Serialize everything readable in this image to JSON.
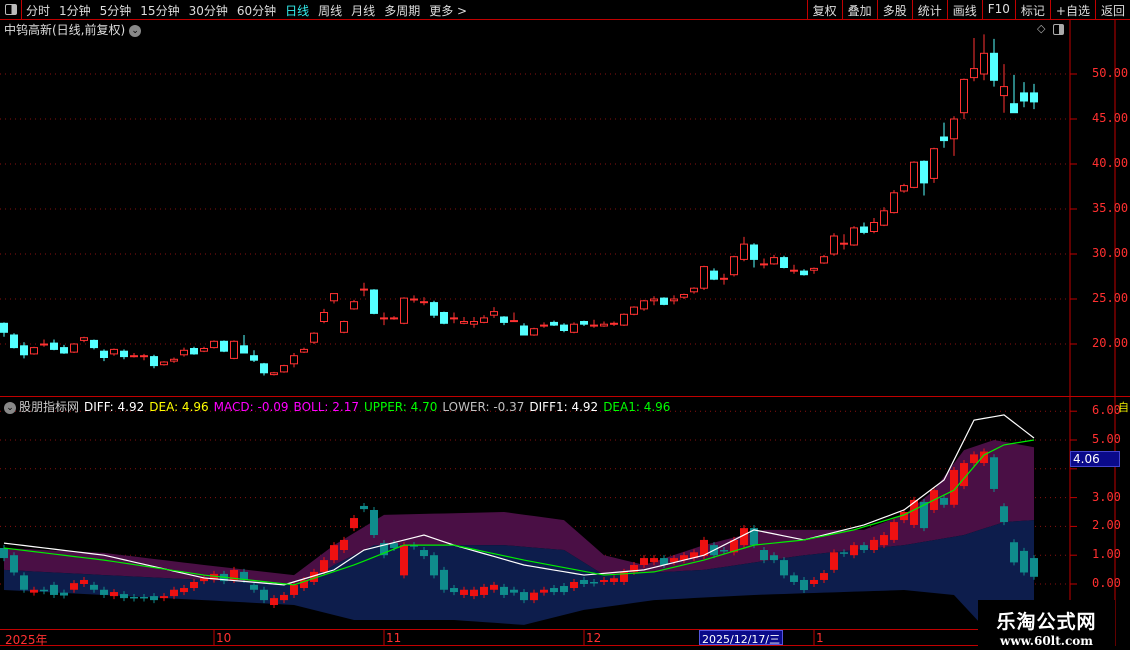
{
  "toolbar": {
    "periods": [
      "分时",
      "1分钟",
      "5分钟",
      "15分钟",
      "30分钟",
      "60分钟",
      "日线",
      "周线",
      "月线",
      "多周期",
      "更多 >"
    ],
    "active_period": "日线",
    "right_buttons": [
      "复权",
      "叠加",
      "多股",
      "统计",
      "画线",
      "F10",
      "标记",
      "+自选",
      "返回"
    ]
  },
  "chart": {
    "title": "中钨高新(日线,前复权)",
    "price_axis": [
      "50.00",
      "45.00",
      "40.00",
      "35.00",
      "30.00",
      "25.00",
      "20.00"
    ],
    "candles_ohlc": [
      [
        22.3,
        22.4,
        20.8,
        21.3
      ],
      [
        21.0,
        21.2,
        19.5,
        19.6
      ],
      [
        19.8,
        20.2,
        18.4,
        18.8
      ],
      [
        18.9,
        19.7,
        18.8,
        19.6
      ],
      [
        20.0,
        20.5,
        19.7,
        20.0
      ],
      [
        20.1,
        20.5,
        19.3,
        19.4
      ],
      [
        19.6,
        19.9,
        18.9,
        19.0
      ],
      [
        19.1,
        20.1,
        19.0,
        20.0
      ],
      [
        20.4,
        20.8,
        20.2,
        20.7
      ],
      [
        20.4,
        20.5,
        19.4,
        19.6
      ],
      [
        19.2,
        19.4,
        18.1,
        18.5
      ],
      [
        18.9,
        19.5,
        18.7,
        19.4
      ],
      [
        19.2,
        19.4,
        18.3,
        18.6
      ],
      [
        18.7,
        19.0,
        18.5,
        18.7
      ],
      [
        18.7,
        18.9,
        18.2,
        18.7
      ],
      [
        18.6,
        18.8,
        17.3,
        17.6
      ],
      [
        17.7,
        18.1,
        17.6,
        18.0
      ],
      [
        18.1,
        18.5,
        17.9,
        18.3
      ],
      [
        18.8,
        19.6,
        18.6,
        19.3
      ],
      [
        19.5,
        19.7,
        18.8,
        18.9
      ],
      [
        19.2,
        19.7,
        19.1,
        19.5
      ],
      [
        19.6,
        20.4,
        19.5,
        20.3
      ],
      [
        20.3,
        20.4,
        19.1,
        19.2
      ],
      [
        18.4,
        20.4,
        18.3,
        20.3
      ],
      [
        19.8,
        21.0,
        19.5,
        19.0
      ],
      [
        18.7,
        19.3,
        18.0,
        18.2
      ],
      [
        17.8,
        17.9,
        16.5,
        16.8
      ],
      [
        16.6,
        16.9,
        16.5,
        16.8
      ],
      [
        16.9,
        17.7,
        16.8,
        17.6
      ],
      [
        17.8,
        19.0,
        17.4,
        18.7
      ],
      [
        19.1,
        19.6,
        19.0,
        19.4
      ],
      [
        20.2,
        21.3,
        20.0,
        21.2
      ],
      [
        22.5,
        23.9,
        22.3,
        23.5
      ],
      [
        24.8,
        25.6,
        24.5,
        25.6
      ],
      [
        21.3,
        22.6,
        21.2,
        22.5
      ],
      [
        23.9,
        24.9,
        23.8,
        24.7
      ],
      [
        26.1,
        26.8,
        25.3,
        26.1
      ],
      [
        26.0,
        26.1,
        23.3,
        23.4
      ],
      [
        22.9,
        23.5,
        22.1,
        22.9
      ],
      [
        22.9,
        23.1,
        22.7,
        22.9
      ],
      [
        22.3,
        25.2,
        22.2,
        25.1
      ],
      [
        25.0,
        25.4,
        24.6,
        25.0
      ],
      [
        24.7,
        25.2,
        24.3,
        24.7
      ],
      [
        24.6,
        24.8,
        22.9,
        23.2
      ],
      [
        23.5,
        23.6,
        22.2,
        22.3
      ],
      [
        22.9,
        23.5,
        22.3,
        22.9
      ],
      [
        22.3,
        23.0,
        22.2,
        22.5
      ],
      [
        22.2,
        23.0,
        21.8,
        22.5
      ],
      [
        22.4,
        23.2,
        22.3,
        22.9
      ],
      [
        23.2,
        24.1,
        22.9,
        23.6
      ],
      [
        23.0,
        23.1,
        22.1,
        22.4
      ],
      [
        22.6,
        23.5,
        22.5,
        22.6
      ],
      [
        22.0,
        22.3,
        21.0,
        21.0
      ],
      [
        21.0,
        21.8,
        20.9,
        21.7
      ],
      [
        22.1,
        22.4,
        21.8,
        22.1
      ],
      [
        22.4,
        22.6,
        22.0,
        22.1
      ],
      [
        22.1,
        22.3,
        21.3,
        21.5
      ],
      [
        21.3,
        22.4,
        21.2,
        22.2
      ],
      [
        22.5,
        22.6,
        22.0,
        22.2
      ],
      [
        22.1,
        22.7,
        21.8,
        22.1
      ],
      [
        22.0,
        22.5,
        21.9,
        22.2
      ],
      [
        22.3,
        22.5,
        22.0,
        22.3
      ],
      [
        22.1,
        23.4,
        22.0,
        23.3
      ],
      [
        23.3,
        24.2,
        23.2,
        24.1
      ],
      [
        23.9,
        24.9,
        23.7,
        24.8
      ],
      [
        24.8,
        25.3,
        24.3,
        25.0
      ],
      [
        25.1,
        25.2,
        24.3,
        24.4
      ],
      [
        24.8,
        25.4,
        24.4,
        25.0
      ],
      [
        25.2,
        25.6,
        25.0,
        25.5
      ],
      [
        25.8,
        26.3,
        25.6,
        26.2
      ],
      [
        26.2,
        28.7,
        26.0,
        28.6
      ],
      [
        28.1,
        28.4,
        27.1,
        27.2
      ],
      [
        27.3,
        27.8,
        26.6,
        27.3
      ],
      [
        27.7,
        29.8,
        27.5,
        29.7
      ],
      [
        29.4,
        31.9,
        29.2,
        31.1
      ],
      [
        31.0,
        31.2,
        28.5,
        29.4
      ],
      [
        28.9,
        29.5,
        28.4,
        28.9
      ],
      [
        28.9,
        29.9,
        28.8,
        29.6
      ],
      [
        29.6,
        29.8,
        28.4,
        28.5
      ],
      [
        28.2,
        28.8,
        27.8,
        28.2
      ],
      [
        28.1,
        28.3,
        27.6,
        27.7
      ],
      [
        28.2,
        28.5,
        27.8,
        28.4
      ],
      [
        29.0,
        29.9,
        28.9,
        29.7
      ],
      [
        30.0,
        32.3,
        29.8,
        32.0
      ],
      [
        31.2,
        32.2,
        30.5,
        31.2
      ],
      [
        31.0,
        33.1,
        30.9,
        32.9
      ],
      [
        33.0,
        33.5,
        32.2,
        32.4
      ],
      [
        32.5,
        34.0,
        32.3,
        33.5
      ],
      [
        33.2,
        35.2,
        33.1,
        34.8
      ],
      [
        34.6,
        37.1,
        34.5,
        36.8
      ],
      [
        37.0,
        37.8,
        36.8,
        37.6
      ],
      [
        37.4,
        40.3,
        37.3,
        40.2
      ],
      [
        40.3,
        40.4,
        36.5,
        37.9
      ],
      [
        38.4,
        41.8,
        37.9,
        41.7
      ],
      [
        43.0,
        44.6,
        41.8,
        42.6
      ],
      [
        42.8,
        45.3,
        40.9,
        45.0
      ],
      [
        45.7,
        49.5,
        45.0,
        49.4
      ],
      [
        49.6,
        54.0,
        49.2,
        50.6
      ],
      [
        50.0,
        54.4,
        49.3,
        52.3
      ],
      [
        52.3,
        53.9,
        48.6,
        49.3
      ],
      [
        47.6,
        51.1,
        45.7,
        48.6
      ],
      [
        46.7,
        49.9,
        45.8,
        45.7
      ],
      [
        47.9,
        49.1,
        46.3,
        47.0
      ],
      [
        47.9,
        48.9,
        46.1,
        46.9
      ]
    ]
  },
  "indicator": {
    "name": "股朋指标网",
    "values": [
      {
        "label": "DIFF: 4.92",
        "color": "#ffffff"
      },
      {
        "label": "DEA: 4.96",
        "color": "#ffff00"
      },
      {
        "label": "MACD: -0.09",
        "color": "#ff00ff"
      },
      {
        "label": "BOLL: 2.17",
        "color": "#ff00ff"
      },
      {
        "label": "UPPER: 4.70",
        "color": "#00ff00"
      },
      {
        "label": "LOWER: -0.37",
        "color": "#c0c0c0"
      },
      {
        "label": "DIFF1: 4.92",
        "color": "#ffffff"
      },
      {
        "label": "DEA1: 4.96",
        "color": "#00ff00"
      }
    ],
    "axis": [
      "6.00",
      "5.00",
      "3.00",
      "2.00",
      "1.00",
      "0.00"
    ],
    "current_label": "4.06",
    "colors": {
      "upper_fill": "#4a0f45",
      "lower_fill": "#0d1d4c",
      "white_line": "#ffffff",
      "green_line": "#00ee00",
      "up": "#ee1111",
      "down": "#0f8c8c"
    },
    "upper_band": [
      [
        0,
        1.25
      ],
      [
        10,
        1.08
      ],
      [
        20,
        0.66
      ],
      [
        29,
        0.31
      ],
      [
        33,
        1.35
      ],
      [
        38,
        2.4
      ],
      [
        50,
        2.5
      ],
      [
        56,
        2.22
      ],
      [
        60,
        1.0
      ],
      [
        64,
        0.66
      ],
      [
        70,
        1.35
      ],
      [
        76,
        1.88
      ],
      [
        86,
        1.88
      ],
      [
        90,
        2.4
      ],
      [
        93,
        3.26
      ],
      [
        96,
        4.65
      ],
      [
        99,
        5.0
      ],
      [
        103,
        4.75
      ]
    ],
    "mid_band": [
      [
        0,
        0.49
      ],
      [
        10,
        0.31
      ],
      [
        20,
        0.14
      ],
      [
        30,
        -0.03
      ],
      [
        33,
        0.66
      ],
      [
        37,
        1.35
      ],
      [
        50,
        1.35
      ],
      [
        56,
        1.18
      ],
      [
        60,
        0.31
      ],
      [
        70,
        0.49
      ],
      [
        80,
        1.0
      ],
      [
        90,
        1.35
      ],
      [
        96,
        1.7
      ],
      [
        100,
        2.15
      ],
      [
        103,
        2.22
      ]
    ],
    "lower_band": [
      [
        0,
        -0.21
      ],
      [
        10,
        -0.38
      ],
      [
        20,
        -0.56
      ],
      [
        29,
        -0.73
      ],
      [
        35,
        -1.25
      ],
      [
        45,
        -1.25
      ],
      [
        52,
        -1.42
      ],
      [
        58,
        -0.9
      ],
      [
        65,
        -0.56
      ],
      [
        75,
        -0.38
      ],
      [
        90,
        -0.21
      ],
      [
        95,
        -0.38
      ],
      [
        98,
        -1.5
      ],
      [
        103,
        -0.56
      ]
    ],
    "white_line": [
      [
        0,
        1.42
      ],
      [
        10,
        1.0
      ],
      [
        20,
        0.21
      ],
      [
        28,
        -0.03
      ],
      [
        33,
        0.49
      ],
      [
        36,
        1.18
      ],
      [
        42,
        1.7
      ],
      [
        45,
        1.35
      ],
      [
        52,
        0.66
      ],
      [
        58,
        0.31
      ],
      [
        64,
        0.49
      ],
      [
        70,
        1.0
      ],
      [
        75,
        1.88
      ],
      [
        80,
        1.53
      ],
      [
        86,
        2.05
      ],
      [
        90,
        2.57
      ],
      [
        94,
        3.61
      ],
      [
        97,
        5.69
      ],
      [
        100,
        5.87
      ],
      [
        103,
        5.07
      ]
    ],
    "green_line": [
      [
        0,
        1.25
      ],
      [
        10,
        0.83
      ],
      [
        20,
        0.31
      ],
      [
        29,
        -0.03
      ],
      [
        35,
        0.66
      ],
      [
        40,
        1.35
      ],
      [
        45,
        1.35
      ],
      [
        52,
        0.83
      ],
      [
        60,
        0.31
      ],
      [
        65,
        0.42
      ],
      [
        70,
        0.83
      ],
      [
        75,
        1.35
      ],
      [
        80,
        1.53
      ],
      [
        85,
        1.88
      ],
      [
        90,
        2.4
      ],
      [
        95,
        3.26
      ],
      [
        98,
        4.48
      ],
      [
        100,
        4.83
      ],
      [
        103,
        5.0
      ]
    ],
    "candles_oc": [
      [
        1.25,
        0.9
      ],
      [
        1.0,
        0.4
      ],
      [
        0.3,
        -0.2
      ],
      [
        -0.3,
        -0.2
      ],
      [
        -0.2,
        -0.2
      ],
      [
        -0.03,
        -0.38
      ],
      [
        -0.3,
        -0.4
      ],
      [
        -0.2,
        0.03
      ],
      [
        0.0,
        0.14
      ],
      [
        -0.03,
        -0.2
      ],
      [
        -0.2,
        -0.38
      ],
      [
        -0.42,
        -0.28
      ],
      [
        -0.35,
        -0.49
      ],
      [
        -0.45,
        -0.45
      ],
      [
        -0.45,
        -0.45
      ],
      [
        -0.42,
        -0.56
      ],
      [
        -0.49,
        -0.42
      ],
      [
        -0.42,
        -0.2
      ],
      [
        -0.28,
        -0.14
      ],
      [
        -0.14,
        0.07
      ],
      [
        0.1,
        0.2
      ],
      [
        0.15,
        0.35
      ],
      [
        0.35,
        0.1
      ],
      [
        0.14,
        0.49
      ],
      [
        0.42,
        0.14
      ],
      [
        -0.03,
        -0.2
      ],
      [
        -0.2,
        -0.56
      ],
      [
        -0.73,
        -0.49
      ],
      [
        -0.56,
        -0.38
      ],
      [
        -0.38,
        -0.03
      ],
      [
        -0.14,
        0.14
      ],
      [
        0.07,
        0.42
      ],
      [
        0.42,
        0.83
      ],
      [
        0.83,
        1.35
      ],
      [
        1.18,
        1.53
      ],
      [
        1.94,
        2.29
      ],
      [
        2.71,
        2.6
      ],
      [
        2.57,
        1.7
      ],
      [
        1.42,
        1.0
      ],
      [
        1.42,
        1.25
      ],
      [
        0.3,
        1.35
      ],
      [
        1.35,
        1.35
      ],
      [
        1.18,
        0.97
      ],
      [
        1.0,
        0.3
      ],
      [
        0.49,
        -0.2
      ],
      [
        -0.14,
        -0.28
      ],
      [
        -0.38,
        -0.2
      ],
      [
        -0.42,
        -0.2
      ],
      [
        -0.38,
        -0.1
      ],
      [
        -0.2,
        -0.03
      ],
      [
        -0.1,
        -0.38
      ],
      [
        -0.2,
        -0.3
      ],
      [
        -0.28,
        -0.56
      ],
      [
        -0.56,
        -0.3
      ],
      [
        -0.3,
        -0.2
      ],
      [
        -0.14,
        -0.28
      ],
      [
        -0.07,
        -0.28
      ],
      [
        -0.14,
        0.07
      ],
      [
        0.14,
        0.0
      ],
      [
        0.07,
        0.07
      ],
      [
        0.07,
        0.14
      ],
      [
        0.07,
        0.2
      ],
      [
        0.07,
        0.42
      ],
      [
        0.42,
        0.66
      ],
      [
        0.66,
        0.9
      ],
      [
        0.76,
        0.9
      ],
      [
        0.9,
        0.66
      ],
      [
        0.76,
        0.9
      ],
      [
        0.83,
        1.0
      ],
      [
        0.9,
        1.1
      ],
      [
        0.97,
        1.53
      ],
      [
        1.35,
        1.0
      ],
      [
        1.18,
        1.18
      ],
      [
        1.1,
        1.53
      ],
      [
        1.35,
        1.94
      ],
      [
        1.94,
        1.35
      ],
      [
        1.18,
        0.83
      ],
      [
        1.0,
        0.83
      ],
      [
        0.83,
        0.3
      ],
      [
        0.3,
        0.07
      ],
      [
        0.14,
        -0.21
      ],
      [
        0.0,
        0.14
      ],
      [
        0.14,
        0.38
      ],
      [
        0.49,
        1.1
      ],
      [
        1.1,
        1.1
      ],
      [
        1.0,
        1.35
      ],
      [
        1.35,
        1.18
      ],
      [
        1.18,
        1.53
      ],
      [
        1.35,
        1.7
      ],
      [
        1.53,
        2.15
      ],
      [
        2.22,
        2.5
      ],
      [
        2.05,
        2.92
      ],
      [
        2.85,
        1.94
      ],
      [
        2.57,
        3.26
      ],
      [
        2.99,
        2.75
      ],
      [
        2.75,
        3.96
      ],
      [
        3.4,
        4.2
      ],
      [
        4.2,
        4.5
      ],
      [
        4.2,
        4.6
      ],
      [
        4.4,
        3.3
      ],
      [
        2.7,
        2.15
      ],
      [
        1.45,
        0.75
      ],
      [
        1.15,
        0.4
      ],
      [
        0.9,
        0.25
      ]
    ]
  },
  "time_axis": {
    "labels": [
      "2025年",
      "10",
      "11",
      "12",
      "1"
    ],
    "label_index": [
      0,
      21,
      38,
      58,
      81
    ],
    "selected_date": "2025/12/17/三"
  },
  "watermark": {
    "name": "乐淘公式网",
    "url": "www.60lt.com"
  },
  "side_strip": {
    "lower_top": "自"
  }
}
